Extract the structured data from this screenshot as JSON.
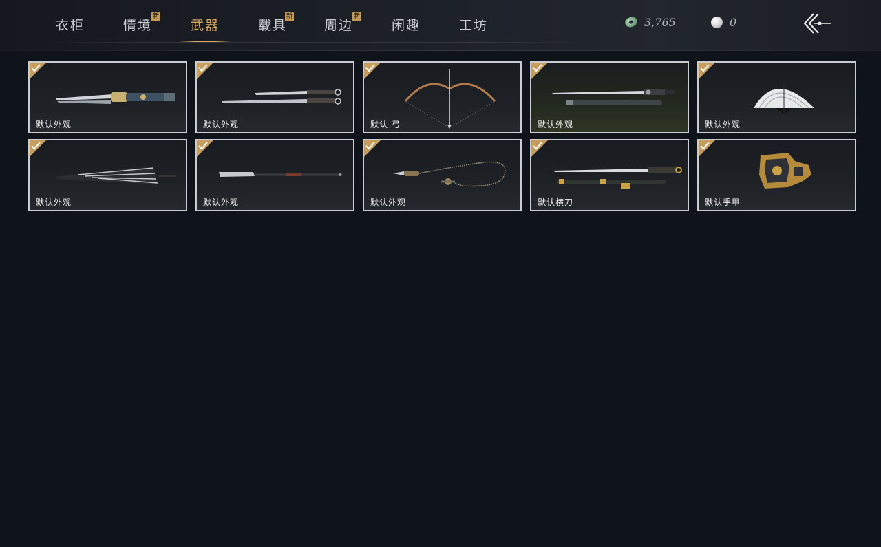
{
  "tabs": [
    {
      "label": "衣柜",
      "new": false,
      "active": false
    },
    {
      "label": "情境",
      "new": true,
      "active": false
    },
    {
      "label": "武器",
      "new": false,
      "active": true
    },
    {
      "label": "载具",
      "new": true,
      "active": false
    },
    {
      "label": "周边",
      "new": true,
      "active": false
    },
    {
      "label": "闲趣",
      "new": false,
      "active": false
    },
    {
      "label": "工坊",
      "new": false,
      "active": false
    }
  ],
  "new_badge_text": "新",
  "currency": {
    "jade": {
      "icon": "jade-coin-icon",
      "value": "3,765"
    },
    "pearl": {
      "icon": "pearl-icon",
      "value": "0"
    }
  },
  "back": {
    "icon": "back-arrow-icon"
  },
  "items": [
    {
      "label": "默认外观",
      "icon": "dual-blades-icon",
      "equipped": true
    },
    {
      "label": "默认外观",
      "icon": "twin-swords-icon",
      "equipped": true
    },
    {
      "label": "默认 弓",
      "icon": "bow-icon",
      "equipped": true
    },
    {
      "label": "默认外观",
      "icon": "long-sword-icon",
      "equipped": true
    },
    {
      "label": "默认外观",
      "icon": "fan-icon",
      "equipped": true
    },
    {
      "label": "默认外观",
      "icon": "umbrella-icon",
      "equipped": true
    },
    {
      "label": "默认外观",
      "icon": "glaive-icon",
      "equipped": true
    },
    {
      "label": "默认外观",
      "icon": "rope-dart-icon",
      "equipped": true
    },
    {
      "label": "默认横刀",
      "icon": "hengdao-icon",
      "equipped": true
    },
    {
      "label": "默认手甲",
      "icon": "gauntlet-icon",
      "equipped": true
    }
  ],
  "colors": {
    "accent": "#d9a65a",
    "badge": "#c69a55",
    "check": "#c79d5b",
    "card_border": "#c9ccd1",
    "background": "#0f131a"
  }
}
